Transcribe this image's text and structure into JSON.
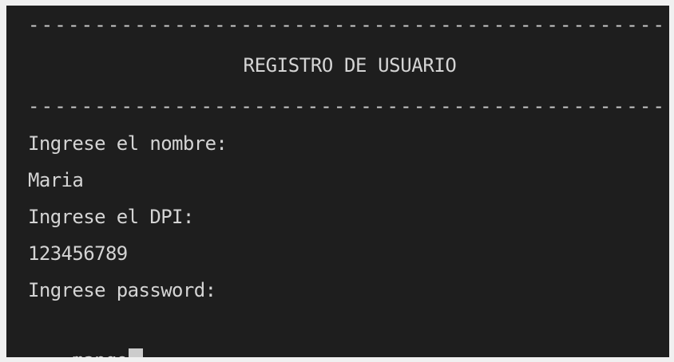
{
  "terminal": {
    "separator_top": "---------------------------------------------------------------",
    "title": "REGISTRO DE USUARIO",
    "separator_bottom": "---------------------------------------------------------------",
    "lines": [
      "Ingrese el nombre:",
      "Maria",
      "Ingrese el DPI:",
      "123456789",
      "Ingrese password:"
    ],
    "input_value": "mango"
  },
  "colors": {
    "background": "#1e1e1e",
    "text": "#d4d4d4",
    "cursor": "#cccccc"
  }
}
